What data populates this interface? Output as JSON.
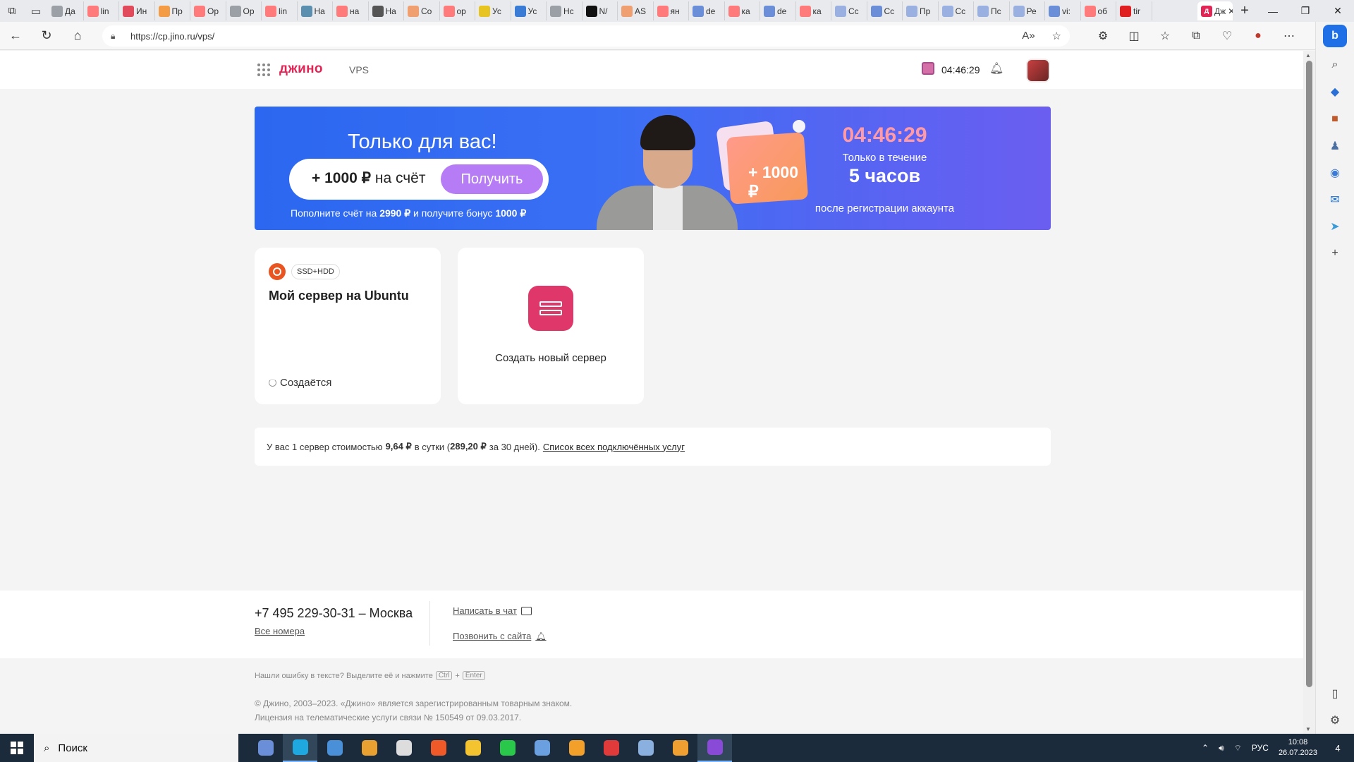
{
  "browser": {
    "tabs": [
      {
        "label": "Да",
        "color": "#9aa0a6"
      },
      {
        "label": "lin",
        "color": "#ff7b7b"
      },
      {
        "label": "Ин",
        "color": "#e04a5a"
      },
      {
        "label": "Пр",
        "color": "#f39b45"
      },
      {
        "label": "Ор",
        "color": "#ff7b7b"
      },
      {
        "label": "Ор",
        "color": "#9aa0a6"
      },
      {
        "label": "lin",
        "color": "#ff7b7b"
      },
      {
        "label": "На",
        "color": "#5a8fb0"
      },
      {
        "label": "на",
        "color": "#ff7b7b"
      },
      {
        "label": "На",
        "color": "#555555"
      },
      {
        "label": "Со",
        "color": "#f0a070"
      },
      {
        "label": "ор",
        "color": "#ff7b7b"
      },
      {
        "label": "Ус",
        "color": "#e8c420"
      },
      {
        "label": "Ус",
        "color": "#3a7bd5"
      },
      {
        "label": "Нс",
        "color": "#9aa0a6"
      },
      {
        "label": "N/",
        "color": "#111111"
      },
      {
        "label": "AS",
        "color": "#f0a070"
      },
      {
        "label": "ян",
        "color": "#ff7b7b"
      },
      {
        "label": "de",
        "color": "#6a8fd8"
      },
      {
        "label": "ка",
        "color": "#ff7b7b"
      },
      {
        "label": "de",
        "color": "#6a8fd8"
      },
      {
        "label": "ка",
        "color": "#ff7b7b"
      },
      {
        "label": "Сс",
        "color": "#9ab0e0"
      },
      {
        "label": "Сс",
        "color": "#6a8fd8"
      },
      {
        "label": "Пр",
        "color": "#9ab0e0"
      },
      {
        "label": "Сс",
        "color": "#9ab0e0"
      },
      {
        "label": "Пс",
        "color": "#9ab0e0"
      },
      {
        "label": "Ре",
        "color": "#9ab0e0"
      },
      {
        "label": "vi:",
        "color": "#6a8fd8"
      },
      {
        "label": "об",
        "color": "#ff7b7b"
      },
      {
        "label": "tir",
        "color": "#e02020"
      }
    ],
    "active_tab": "Дж",
    "url": "https://cp.jino.ru/vps/"
  },
  "header": {
    "logo": "джино",
    "section": "VPS",
    "timer": "04:46:29"
  },
  "promo": {
    "title": "Только для вас!",
    "amount_bold": "+ 1000 ₽",
    "amount_rest": "на счёт",
    "button": "Получить",
    "sub_prefix": "Пополните счёт на",
    "sub_amount": "2990 ₽",
    "sub_middle": "и получите бонус",
    "sub_bonus": "1000 ₽",
    "card_label": "+ 1000 ₽",
    "countdown": "04:46:29",
    "only_within": "Только в течение",
    "hours": "5 часов",
    "after": "после регистрации аккаунта"
  },
  "server_card": {
    "tag": "SSD+HDD",
    "name": "Мой сервер на Ubuntu",
    "status": "Создаётся"
  },
  "create_card": {
    "label": "Создать новый сервер"
  },
  "info": {
    "prefix": "У вас 1 сервер стоимостью",
    "daily": "9,64 ₽",
    "mid": "в сутки (",
    "monthly": "289,20 ₽",
    "suffix": "за 30 дней).",
    "link": "Список всех подключённых услуг"
  },
  "footer": {
    "phone": "+7 495 229-30-31 – Москва",
    "all_numbers": "Все номера",
    "chat": "Написать в чат",
    "call": "Позвонить с сайта",
    "hint_prefix": "Нашли ошибку в тексте? Выделите её и нажмите",
    "key_ctrl": "Ctrl",
    "key_plus": "+",
    "key_enter": "Enter",
    "copyright": "© Джино, 2003–2023. «Джино» является зарегистрированным товарным знаком.",
    "license": "Лицензия на телематические услуги связи № 150549 от 09.03.2017."
  },
  "taskbar": {
    "search": "Поиск",
    "lang": "РУС",
    "time": "10:08",
    "date": "26.07.2023",
    "notifications": "4",
    "apps": [
      {
        "name": "taskview",
        "color": "#6a8fd8"
      },
      {
        "name": "edge",
        "color": "#1fa8e0"
      },
      {
        "name": "calculator",
        "color": "#4a90d9"
      },
      {
        "name": "paint",
        "color": "#e8a030"
      },
      {
        "name": "tool",
        "color": "#dddddd"
      },
      {
        "name": "brave",
        "color": "#f05a28"
      },
      {
        "name": "explorer",
        "color": "#f4c430"
      },
      {
        "name": "phone",
        "color": "#2ac84a"
      },
      {
        "name": "virtualbox",
        "color": "#6aa0e0"
      },
      {
        "name": "sublime",
        "color": "#f2a02a"
      },
      {
        "name": "anydesk",
        "color": "#e03a3a"
      },
      {
        "name": "network",
        "color": "#8ab0e0"
      },
      {
        "name": "ubuntu",
        "color": "#f0a030"
      },
      {
        "name": "visualstudio",
        "color": "#8a4ad8"
      }
    ]
  }
}
